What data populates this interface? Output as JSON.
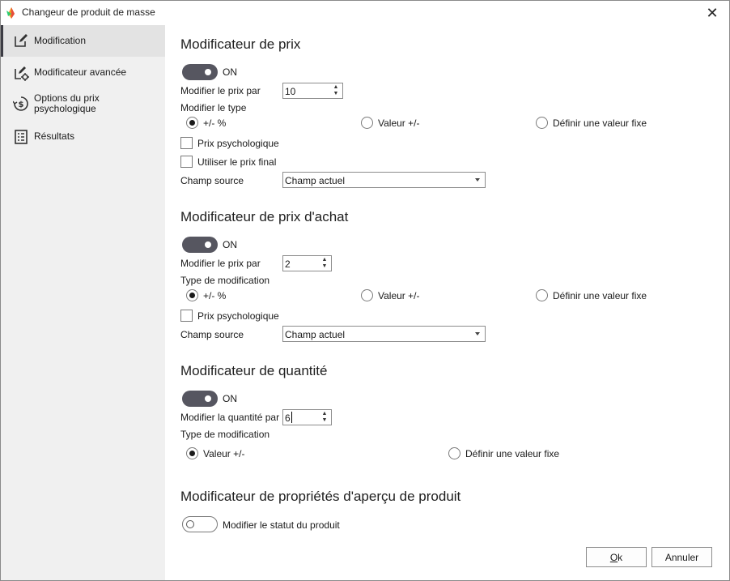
{
  "window": {
    "title": "Changeur de produit de masse",
    "close_symbol": "✕"
  },
  "sidebar": {
    "items": [
      {
        "label": "Modification",
        "icon": "edit-icon",
        "active": true
      },
      {
        "label": "Modificateur avancée",
        "icon": "advanced-edit-icon",
        "active": false
      },
      {
        "label": "Options du prix psychologique",
        "icon": "price-options-icon",
        "active": false
      },
      {
        "label": "Résultats",
        "icon": "results-icon",
        "active": false
      }
    ]
  },
  "sections": {
    "price": {
      "title": "Modificateur de prix",
      "toggle_label": "ON",
      "modify_by_label": "Modifier le prix par",
      "modify_by_value": "10",
      "type_label": "Modifier le type",
      "radios": [
        "+/- %",
        "Valeur +/-",
        "Définir une valeur fixe"
      ],
      "selected_radio": "+/- %",
      "checkbox_psych": "Prix psychologique",
      "checkbox_final": "Utiliser le prix final",
      "source_label": "Champ source",
      "source_value": "Champ actuel"
    },
    "purchase": {
      "title": "Modificateur de prix d'achat",
      "toggle_label": "ON",
      "modify_by_label": "Modifier le prix par",
      "modify_by_value": "2",
      "type_label": "Type de modification",
      "radios": [
        "+/- %",
        "Valeur +/-",
        "Définir une valeur fixe"
      ],
      "selected_radio": "+/- %",
      "checkbox_psych": "Prix psychologique",
      "source_label": "Champ source",
      "source_value": "Champ actuel"
    },
    "quantity": {
      "title": "Modificateur de quantité",
      "toggle_label": "ON",
      "modify_by_label": "Modifier la quantité par",
      "modify_by_value": "6",
      "type_label": "Type de modification",
      "radios": [
        "Valeur +/-",
        "Définir une valeur fixe"
      ],
      "selected_radio": "Valeur +/-"
    },
    "preview": {
      "title": "Modificateur de propriétés d'aperçu de produit",
      "toggle_label": "Modifier le statut du produit"
    }
  },
  "buttons": {
    "ok_mnemonic": "O",
    "ok_rest": "k",
    "cancel": "Annuler"
  },
  "colors": {
    "toggle_on": "#565660",
    "sidebar_bg": "#f0f0f0",
    "sidebar_active": "#e3e3e3"
  }
}
